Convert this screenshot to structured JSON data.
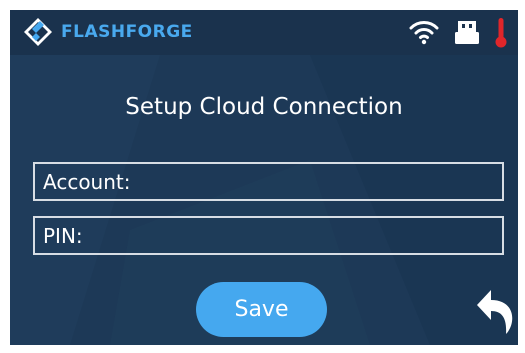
{
  "header": {
    "brand": "FLASHFORGE",
    "status_icons": [
      "wifi-icon",
      "usb-drive-icon",
      "thermometer-icon"
    ]
  },
  "page": {
    "title": "Setup Cloud Connection"
  },
  "form": {
    "account": {
      "label": "Account:",
      "value": ""
    },
    "pin": {
      "label": "PIN:",
      "value": ""
    }
  },
  "actions": {
    "save_label": "Save",
    "back_icon": "back-arrow-icon"
  },
  "colors": {
    "background": "#1d3957",
    "header": "#1a324d",
    "accent": "#45a8ef",
    "brand_text": "#49a9ee",
    "field_border": "#d7dde4",
    "temperature_alert": "#e0262a"
  }
}
